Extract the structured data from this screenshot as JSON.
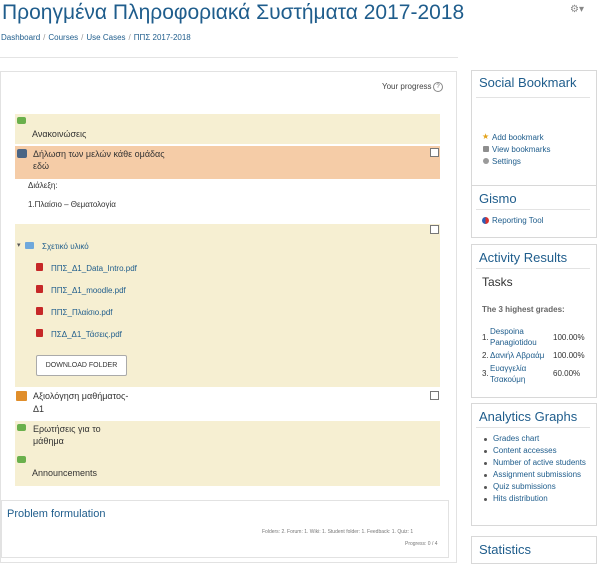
{
  "header": {
    "title": "Προηγμένα Πληροφοριακά Συστήματα 2017-2018",
    "breadcrumb": [
      "Dashboard",
      "Courses",
      "Use Cases",
      "ΠΠΣ 2017-2018"
    ],
    "breadcrumb_sep": "/"
  },
  "main": {
    "progress_label": "Your progress",
    "sections": {
      "announcements_gr": "Ανακοινώσεις",
      "members_line1": "Δήλωση των μελών κάθε ομάδας",
      "members_line2": "εδώ",
      "lecture_label": "Διάλεξη:",
      "lecture_topic": "1.Πλαίσιο – Θεματολογία",
      "folder_name": "Σχετικό υλικό",
      "files": [
        "ΠΠΣ_Δ1_Data_Intro.pdf",
        "ΠΠΣ_Δ1_moodle.pdf",
        "ΠΠΣ_Πλαίσιο.pdf",
        "ΠΣΔ_Δ1_Τάσεις.pdf"
      ],
      "download_folder": "DOWNLOAD FOLDER",
      "evaluation_line1": "Αξιολόγηση μαθήματος-",
      "evaluation_line2": "Δ1",
      "questions_line1": "Ερωτήσεις για το",
      "questions_line2": "μάθημα",
      "announcements_en": "Announcements"
    },
    "problem": {
      "title": "Problem formulation",
      "summary": "Folders: 2. Forum: 1. Wiki: 1. Student folder: 1. Feedback: 1. Quiz: 1",
      "progress": "Progress: 0 / 4"
    }
  },
  "sidebar": {
    "social": {
      "title": "Social Bookmark",
      "items": [
        "Add bookmark",
        "View bookmarks",
        "Settings"
      ]
    },
    "gismo": {
      "title": "Gismo",
      "item": "Reporting Tool"
    },
    "activity": {
      "title": "Activity Results",
      "subtitle": "Tasks",
      "highest": "The 3 highest grades:",
      "grades": [
        {
          "rank": "1.",
          "name_line1": "Despoina",
          "name_line2": "Panagiotidou",
          "value": "100.00%"
        },
        {
          "rank": "2.",
          "name_line1": "Δανιήλ Αβραάμ",
          "name_line2": "",
          "value": "100.00%"
        },
        {
          "rank": "3.",
          "name_line1": "Ευαγγελία",
          "name_line2": "Τσακούμη",
          "value": "60.00%"
        }
      ]
    },
    "analytics": {
      "title": "Analytics Graphs",
      "items": [
        "Grades chart",
        "Content accesses",
        "Number of active students",
        "Assignment submissions",
        "Quiz submissions",
        "Hits distribution"
      ]
    },
    "statistics": {
      "title": "Statistics"
    }
  },
  "icons": {
    "gear": "⚙▾",
    "help": "?",
    "star": "★",
    "folder_toggle": "▾"
  },
  "colors": {
    "link": "#1f5d8c",
    "section_beige": "#f6efd2",
    "section_peach": "#f5cca7"
  }
}
